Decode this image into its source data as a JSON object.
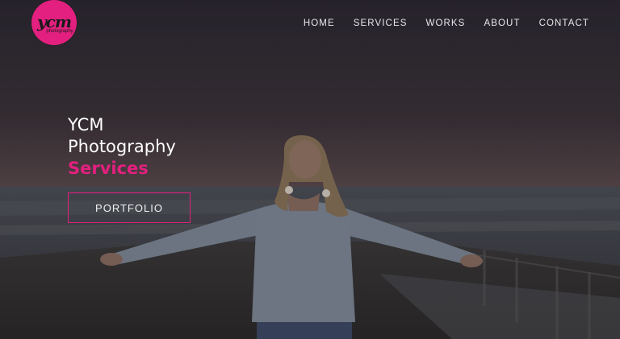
{
  "colors": {
    "accent": "#e3207f",
    "nav_text": "#e8e8e8",
    "heading_text": "#ffffff"
  },
  "brand": {
    "logo_mark": "ycm",
    "logo_sub": "photography"
  },
  "nav": {
    "items": [
      {
        "label": "HOME"
      },
      {
        "label": "SERVICES"
      },
      {
        "label": "WORKS"
      },
      {
        "label": "ABOUT"
      },
      {
        "label": "CONTACT"
      }
    ]
  },
  "hero": {
    "line1": "YCM",
    "line2": "Photography",
    "line3": "Services",
    "cta_label": "PORTFOLIO"
  }
}
